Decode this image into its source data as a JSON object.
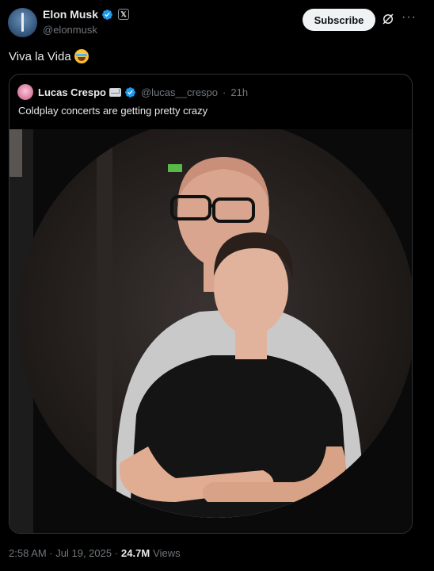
{
  "author": {
    "name": "Elon Musk",
    "handle": "@elonmusk",
    "x_badge": "𝕏",
    "verified_icon": "verified-badge-icon"
  },
  "actions": {
    "subscribe_label": "Subscribe",
    "more_label": "···"
  },
  "tweet": {
    "text": "Viva la Vida",
    "emoji_icon": "face-with-tears-of-joy-icon"
  },
  "quote": {
    "name": "Lucas Crespo",
    "handle": "@lucas__crespo",
    "separator": "·",
    "time": "21h",
    "text": "Coldplay concerts are getting pretty crazy"
  },
  "footer": {
    "timestamp": "2:58 AM · Jul 19, 2025 ·",
    "views_count": "24.7M",
    "views_label": "Views"
  },
  "colors": {
    "background": "#000000",
    "text": "#e7e9ea",
    "muted": "#71767b",
    "verified": "#1d9bf0",
    "border": "#2f3336"
  }
}
